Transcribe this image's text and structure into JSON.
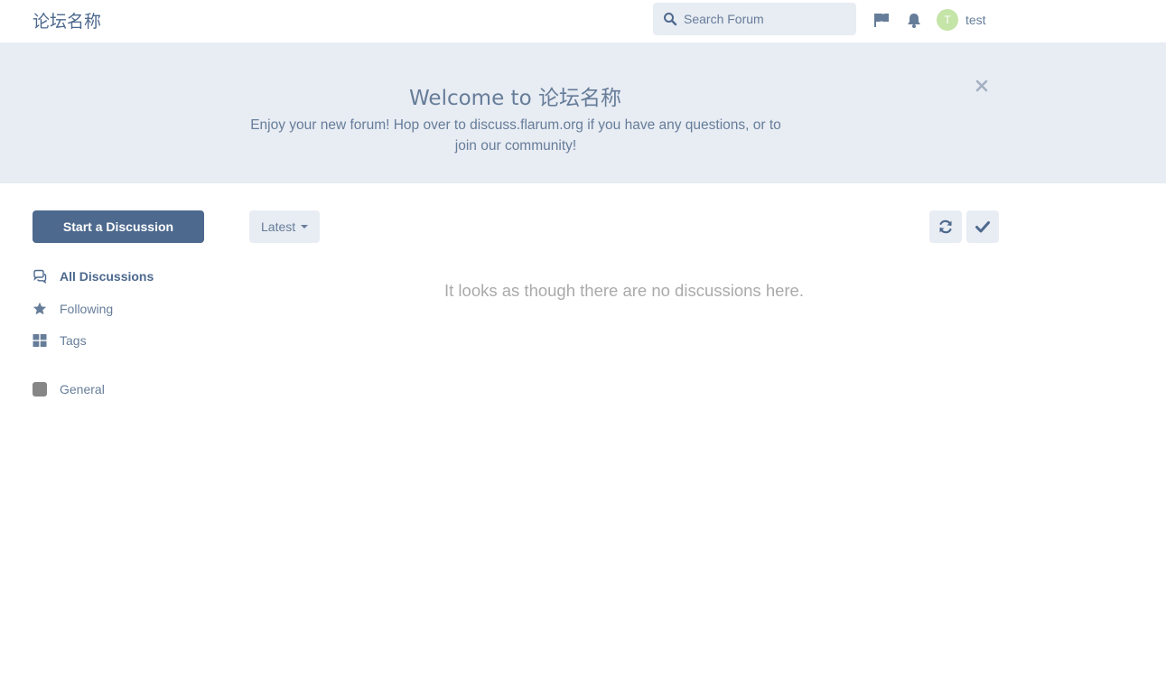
{
  "header": {
    "brand": "论坛名称",
    "search_placeholder": "Search Forum",
    "user": {
      "avatar_letter": "T",
      "name": "test"
    },
    "icons": [
      "search-icon",
      "flag-icon",
      "bell-icon"
    ]
  },
  "hero": {
    "title": "Welcome to 论坛名称",
    "text": "Enjoy your new forum! Hop over to discuss.flarum.org if you have any questions, or to join our community!",
    "close_icon": "close-icon"
  },
  "sidebar": {
    "start_button": "Start a Discussion",
    "nav": [
      {
        "label": "All Discussions",
        "icon": "comments-icon",
        "active": true
      },
      {
        "label": "Following",
        "icon": "star-icon",
        "active": false
      },
      {
        "label": "Tags",
        "icon": "grid-icon",
        "active": false
      }
    ],
    "tags": [
      {
        "label": "General",
        "color": "#868686"
      }
    ]
  },
  "toolbar": {
    "sort_label": "Latest",
    "refresh_icon": "refresh-icon",
    "mark_read_icon": "check-icon"
  },
  "main": {
    "empty_message": "It looks as though there are no discussions here."
  },
  "colors": {
    "primary": "#4d698e",
    "muted": "#667d99",
    "hero_bg": "#e8ecf3"
  }
}
